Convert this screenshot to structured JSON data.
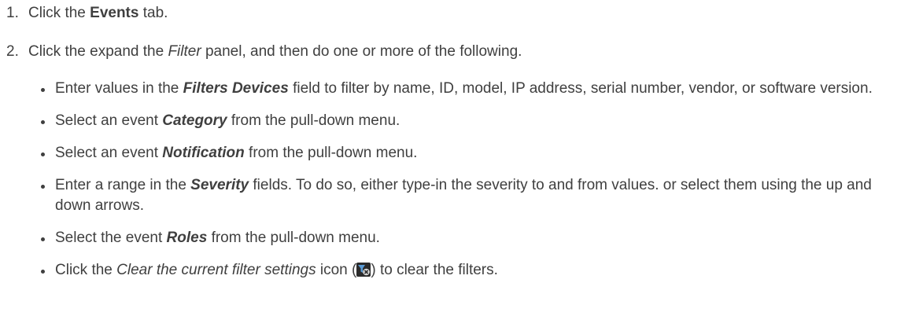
{
  "steps": [
    {
      "num": "1.",
      "pre": "Click the ",
      "bold": "Events",
      "post": " tab."
    },
    {
      "num": "2.",
      "pre": "Click the expand the ",
      "italic": "Filter",
      "post": " panel, and then do one or more of the following."
    }
  ],
  "bullets": [
    {
      "pre": "Enter values in the ",
      "em": "Filters Devices",
      "post": " field to filter by name, ID, model, IP address, serial number, vendor, or software version."
    },
    {
      "pre": "Select an event ",
      "em": "Category",
      "post": " from the pull-down menu."
    },
    {
      "pre": "Select an event ",
      "em": "Notification",
      "post": " from the pull-down menu."
    },
    {
      "pre": "Enter a range in the ",
      "em": "Severity",
      "post": " fields. To do so, either type-in the severity to and from values. or select them using the up and down arrows."
    },
    {
      "pre": "Select the event ",
      "em": "Roles",
      "post": " from the pull-down menu."
    },
    {
      "pre": "Click the ",
      "em": "Clear the current filter settings",
      "mid": " icon (",
      "icon": "clear-filter-icon",
      "post": ") to clear the filters."
    }
  ],
  "colors": {
    "text": "#3f3f3f",
    "icon_bg": "#2b2b2b"
  }
}
